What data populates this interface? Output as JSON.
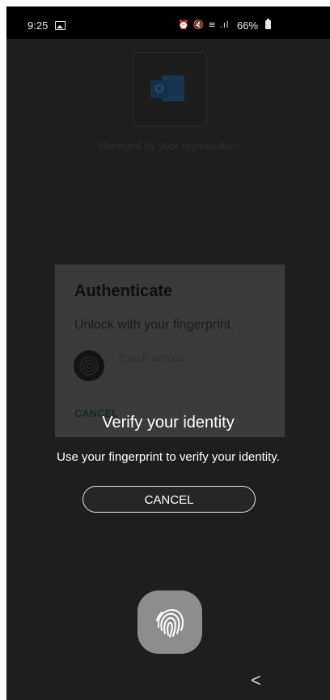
{
  "status_bar": {
    "time": "9:25",
    "system_icons": "⏰ 🔇 ≋ .ıl",
    "battery": "66%"
  },
  "background_app": {
    "logo_letter": "O",
    "managed_text": "Managed by your organization"
  },
  "auth_dialog": {
    "title": "Authenticate",
    "subtitle": "Unlock with your fingerprint.",
    "sensor_label": "Touch sensor",
    "cancel_label": "CANCEL"
  },
  "biometric_prompt": {
    "title": "Verify your identity",
    "message": "Use your fingerprint to verify your identity.",
    "cancel_label": "CANCEL"
  },
  "navigation": {
    "back_glyph": "<"
  },
  "colors": {
    "screen_bg": "#1e1e1e",
    "dialog_bg": "#3b3b3b",
    "fingerprint_button": "#8d8d8d"
  }
}
